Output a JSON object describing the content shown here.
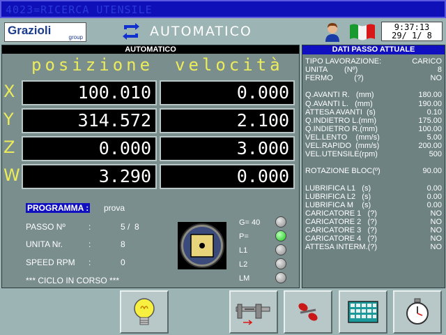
{
  "title_bar": "4023=RICERCA UTENSILE",
  "logo": {
    "brand": "Grazioli",
    "sub": "group"
  },
  "mode_title": "AUTOMATICO",
  "clock": {
    "time": "9:37:13",
    "date": "29/ 1/ 8"
  },
  "left_panel": {
    "heading": "AUTOMATICO",
    "col_position": "posizione",
    "col_velocity": "velocità",
    "axes": [
      {
        "letter": "X",
        "position": "100.010",
        "velocity": "0.000"
      },
      {
        "letter": "Y",
        "position": "314.572",
        "velocity": "2.100"
      },
      {
        "letter": "Z",
        "position": "0.000",
        "velocity": "3.000"
      },
      {
        "letter": "W",
        "position": "3.290",
        "velocity": "0.000"
      }
    ],
    "program_label": "PROGRAMMA",
    "program_colon": ":",
    "program_value": "prova",
    "step_label": "PASSO Nº",
    "step_colon": ":",
    "step_value": "5 /  8",
    "unit_label": "UNITA Nr.",
    "unit_colon": ":",
    "unit_value": "8",
    "speed_label": "SPEED RPM",
    "speed_colon": ":",
    "speed_value": "0",
    "cycle_status": "*** CICLO IN CORSO ***",
    "indicators": [
      {
        "label": "G=",
        "value": "40",
        "on": false
      },
      {
        "label": "P=",
        "value": "",
        "on": true
      },
      {
        "label": "L1",
        "value": "",
        "on": false
      },
      {
        "label": "L2",
        "value": "",
        "on": false
      },
      {
        "label": "LM",
        "value": "",
        "on": false
      }
    ]
  },
  "right_panel": {
    "heading": "DATI PASSO ATTUALE",
    "rows": [
      {
        "label": "TIPO LAVORAZIONE:",
        "value": "CARICO"
      },
      {
        "label": "UNITA        (Nº)",
        "value": "8"
      },
      {
        "label": "FERMO          (?)",
        "value": "NO"
      },
      {
        "label": "",
        "value": ""
      },
      {
        "label": "Q.AVANTI R.   (mm)",
        "value": "180.00"
      },
      {
        "label": "Q.AVANTI L.   (mm)",
        "value": "190.00"
      },
      {
        "label": "ATTESA AVANTI  (s)",
        "value": "0.10"
      },
      {
        "label": "Q.INDIETRO L.(mm)",
        "value": "175.00"
      },
      {
        "label": "Q.INDIETRO R.(mm)",
        "value": "100.00"
      },
      {
        "label": "VEL.LENTO    (mm/s)",
        "value": "5.00"
      },
      {
        "label": "VEL.RAPIDO  (mm/s)",
        "value": "200.00"
      },
      {
        "label": "VEL.UTENSILE(rpm)",
        "value": "500"
      },
      {
        "label": "",
        "value": ""
      },
      {
        "label": "ROTAZIONE BLOC(º)",
        "value": "90.00"
      },
      {
        "label": "",
        "value": ""
      },
      {
        "label": "LUBRIFICA L1   (s)",
        "value": "0.00"
      },
      {
        "label": "LUBRIFICA L2   (s)",
        "value": "0.00"
      },
      {
        "label": "LUBRIFICA M    (s)",
        "value": "0.00"
      },
      {
        "label": "CARICATORE 1   (?)",
        "value": "NO"
      },
      {
        "label": "CARICATORE 2   (?)",
        "value": "NO"
      },
      {
        "label": "CARICATORE 3   (?)",
        "value": "NO"
      },
      {
        "label": "CARICATORE 4   (?)",
        "value": "NO"
      },
      {
        "label": "ATTESA INTERM.(?)",
        "value": "NO"
      }
    ]
  },
  "buttons": [
    {
      "icon": "lightbulb-icon"
    },
    {
      "icon": "caliper-icon"
    },
    {
      "icon": "tools-icon"
    },
    {
      "icon": "keypad-icon"
    },
    {
      "icon": "stopwatch-icon"
    }
  ],
  "colors": {
    "title_bar": "#1010b8",
    "accent_yellow": "#ecec5a",
    "panel_head_blue": "#1010c0",
    "led_green": "#18c818"
  }
}
